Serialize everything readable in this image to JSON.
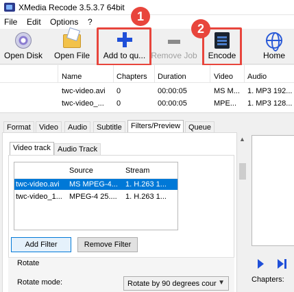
{
  "window": {
    "title": "XMedia Recode 3.5.3.7 64bit"
  },
  "menu": {
    "items": [
      "File",
      "Edit",
      "Options",
      "?"
    ]
  },
  "toolbar": {
    "open_disk": "Open Disk",
    "open_file": "Open File",
    "add_to_queue": "Add to qu...",
    "remove_job": "Remove Job",
    "encode": "Encode",
    "home": "Home"
  },
  "annotations": {
    "badge1": "1",
    "badge2": "2",
    "highlight_color": "#e8453c"
  },
  "filelist": {
    "columns": [
      "Name",
      "Chapters",
      "Duration",
      "Video",
      "Audio"
    ],
    "rows": [
      [
        "twc-video.avi",
        "0",
        "00:00:05",
        "MS M...",
        "1. MP3 192..."
      ],
      [
        "twc-video_...",
        "0",
        "00:00:05",
        "MPE...",
        "1. MP3 128..."
      ]
    ]
  },
  "tabs": [
    "Format",
    "Video",
    "Audio",
    "Subtitle",
    "Filters/Preview",
    "Queue"
  ],
  "active_tab": "Filters/Preview",
  "subtabs": [
    "Video track",
    "Audio Track"
  ],
  "tracklist": {
    "columns": [
      "",
      "Source",
      "Stream"
    ],
    "rows": [
      [
        "twc-video.avi",
        "MS MPEG-4...",
        "1. H.263 1..."
      ],
      [
        "twc-video_1...",
        "MPEG-4 25....",
        "1. H.263 1..."
      ]
    ],
    "selected_index": 0
  },
  "buttons": {
    "add_filter": "Add Filter",
    "remove_filter": "Remove Filter"
  },
  "rotate": {
    "group_label": "Rotate",
    "mode_label": "Rotate mode:",
    "mode_value": "Rotate by 90 degrees cour"
  },
  "preview": {
    "chapters_label": "Chapters:"
  },
  "colors": {
    "selection": "#0078d7",
    "accent_blue": "#1f4fd8"
  }
}
